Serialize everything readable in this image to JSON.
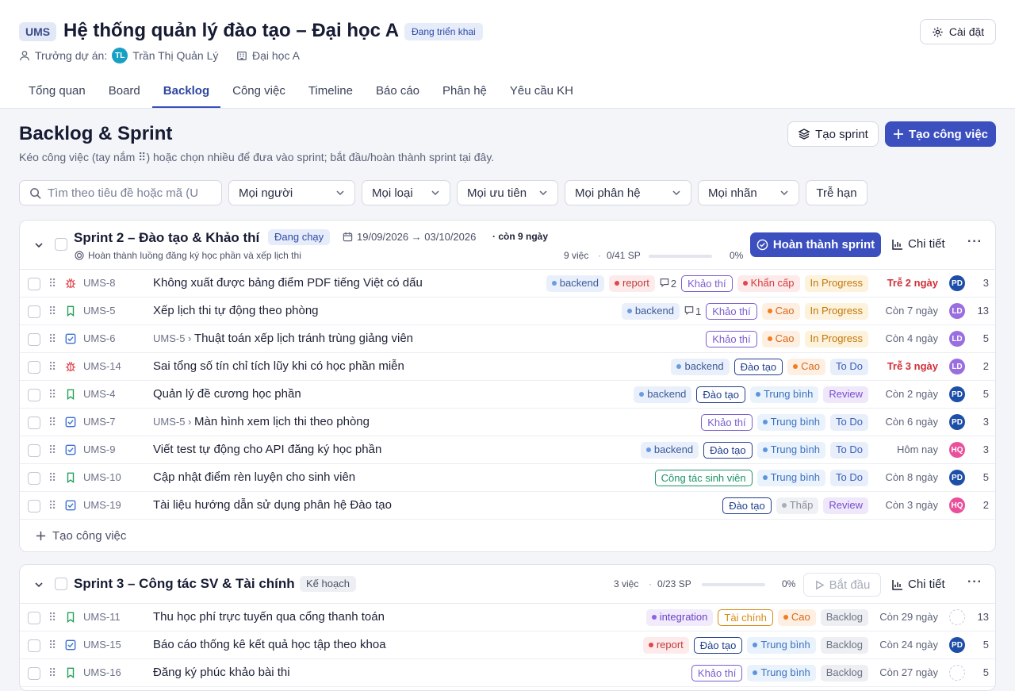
{
  "project": {
    "code": "UMS",
    "title": "Hệ thống quản lý đào tạo – Đại học A",
    "status": "Đang triển khai",
    "manager_label": "Trưởng dự án:",
    "manager_initials": "TL",
    "manager_name": "Trần Thị Quản Lý",
    "org": "Đại học A",
    "settings_label": "Cài đặt"
  },
  "tabs": [
    "Tổng quan",
    "Board",
    "Backlog",
    "Công việc",
    "Timeline",
    "Báo cáo",
    "Phân hệ",
    "Yêu cầu KH"
  ],
  "active_tab": "Backlog",
  "page": {
    "title": "Backlog & Sprint",
    "subtitle": "Kéo công việc (tay nắm ⠿) hoặc chọn nhiều để đưa vào sprint; bắt đầu/hoàn thành sprint tại đây.",
    "create_sprint": "Tạo sprint",
    "create_task": "Tạo công việc"
  },
  "filters": {
    "search_placeholder": "Tìm theo tiêu đề hoặc mã (U",
    "people": "Mọi người",
    "type": "Mọi loại",
    "priority": "Mọi ưu tiên",
    "module": "Mọi phân hệ",
    "label": "Mọi nhãn",
    "overdue": "Trễ hạn"
  },
  "sprint2": {
    "name": "Sprint 2 – Đào tạo & Khảo thí",
    "status": "Đang chạy",
    "dates": "19/09/2026 → 03/10/2026",
    "remaining": "· còn 9 ngày",
    "goal": "Hoàn thành luồng đăng ký học phần và xếp lịch thi",
    "count": "9 việc",
    "points": "0/41 SP",
    "percent": "0%",
    "progress": 0,
    "complete_label": "Hoàn thành sprint",
    "detail_label": "Chi tiết",
    "add_label": "Tạo công việc",
    "rows": [
      {
        "type": "bug",
        "key": "UMS-8",
        "parent": "",
        "title": "Không xuất được bảng điểm PDF tiếng Việt có dấu",
        "labels": [
          "backend",
          "report"
        ],
        "comments": "2",
        "module": "Khảo thí",
        "priority": "Khẩn cấp",
        "status": "In Progress",
        "due": "Trễ 2 ngày",
        "late": true,
        "assignee": "PD",
        "sp": "3"
      },
      {
        "type": "story",
        "key": "UMS-5",
        "parent": "",
        "title": "Xếp lịch thi tự động theo phòng",
        "labels": [
          "backend"
        ],
        "comments": "1",
        "module": "Khảo thí",
        "priority": "Cao",
        "status": "In Progress",
        "due": "Còn 7 ngày",
        "late": false,
        "assignee": "LD",
        "sp": "13"
      },
      {
        "type": "task",
        "key": "UMS-6",
        "parent": "UMS-5 ›",
        "title": "Thuật toán xếp lịch tránh trùng giảng viên",
        "labels": [],
        "comments": "",
        "module": "Khảo thí",
        "priority": "Cao",
        "status": "In Progress",
        "due": "Còn 4 ngày",
        "late": false,
        "assignee": "LD",
        "sp": "5"
      },
      {
        "type": "bug",
        "key": "UMS-14",
        "parent": "",
        "title": "Sai tổng số tín chỉ tích lũy khi có học phần miễn",
        "labels": [
          "backend"
        ],
        "comments": "",
        "module": "Đào tạo",
        "priority": "Cao",
        "status": "To Do",
        "due": "Trễ 3 ngày",
        "late": true,
        "assignee": "LD",
        "sp": "2"
      },
      {
        "type": "story",
        "key": "UMS-4",
        "parent": "",
        "title": "Quản lý đề cương học phần",
        "labels": [
          "backend"
        ],
        "comments": "",
        "module": "Đào tạo",
        "priority": "Trung bình",
        "status": "Review",
        "due": "Còn 2 ngày",
        "late": false,
        "assignee": "PD",
        "sp": "5"
      },
      {
        "type": "task",
        "key": "UMS-7",
        "parent": "UMS-5 ›",
        "title": "Màn hình xem lịch thi theo phòng",
        "labels": [],
        "comments": "",
        "module": "Khảo thí",
        "priority": "Trung bình",
        "status": "To Do",
        "due": "Còn 6 ngày",
        "late": false,
        "assignee": "PD",
        "sp": "3"
      },
      {
        "type": "task",
        "key": "UMS-9",
        "parent": "",
        "title": "Viết test tự động cho API đăng ký học phần",
        "labels": [
          "backend"
        ],
        "comments": "",
        "module": "Đào tạo",
        "priority": "Trung bình",
        "status": "To Do",
        "due": "Hôm nay",
        "late": false,
        "assignee": "HQ",
        "sp": "3"
      },
      {
        "type": "story",
        "key": "UMS-10",
        "parent": "",
        "title": "Cập nhật điểm rèn luyện cho sinh viên",
        "labels": [],
        "comments": "",
        "module": "Công tác sinh viên",
        "priority": "Trung bình",
        "status": "To Do",
        "due": "Còn 8 ngày",
        "late": false,
        "assignee": "PD",
        "sp": "5"
      },
      {
        "type": "task",
        "key": "UMS-19",
        "parent": "",
        "title": "Tài liệu hướng dẫn sử dụng phân hệ Đào tạo",
        "labels": [],
        "comments": "",
        "module": "Đào tạo",
        "priority": "Thấp",
        "status": "Review",
        "due": "Còn 3 ngày",
        "late": false,
        "assignee": "HQ",
        "sp": "2"
      }
    ]
  },
  "sprint3": {
    "name": "Sprint 3 – Công tác SV & Tài chính",
    "status": "Kế hoạch",
    "count": "3 việc",
    "points": "0/23 SP",
    "percent": "0%",
    "progress": 0,
    "start_label": "Bắt đầu",
    "detail_label": "Chi tiết",
    "rows": [
      {
        "type": "story",
        "key": "UMS-11",
        "parent": "",
        "title": "Thu học phí trực tuyến qua cổng thanh toán",
        "labels": [
          "integration"
        ],
        "comments": "",
        "module": "Tài chính",
        "priority": "Cao",
        "status": "Backlog",
        "due": "Còn 29 ngày",
        "late": false,
        "assignee": "",
        "sp": "13"
      },
      {
        "type": "task",
        "key": "UMS-15",
        "parent": "",
        "title": "Báo cáo thống kê kết quả học tập theo khoa",
        "labels": [
          "report"
        ],
        "comments": "",
        "module": "Đào tạo",
        "priority": "Trung bình",
        "status": "Backlog",
        "due": "Còn 24 ngày",
        "late": false,
        "assignee": "PD",
        "sp": "5"
      },
      {
        "type": "story",
        "key": "UMS-16",
        "parent": "",
        "title": "Đăng ký phúc khảo bài thi",
        "labels": [],
        "comments": "",
        "module": "Khảo thí",
        "priority": "Trung bình",
        "status": "Backlog",
        "due": "Còn 27 ngày",
        "late": false,
        "assignee": "",
        "sp": "5"
      }
    ]
  }
}
